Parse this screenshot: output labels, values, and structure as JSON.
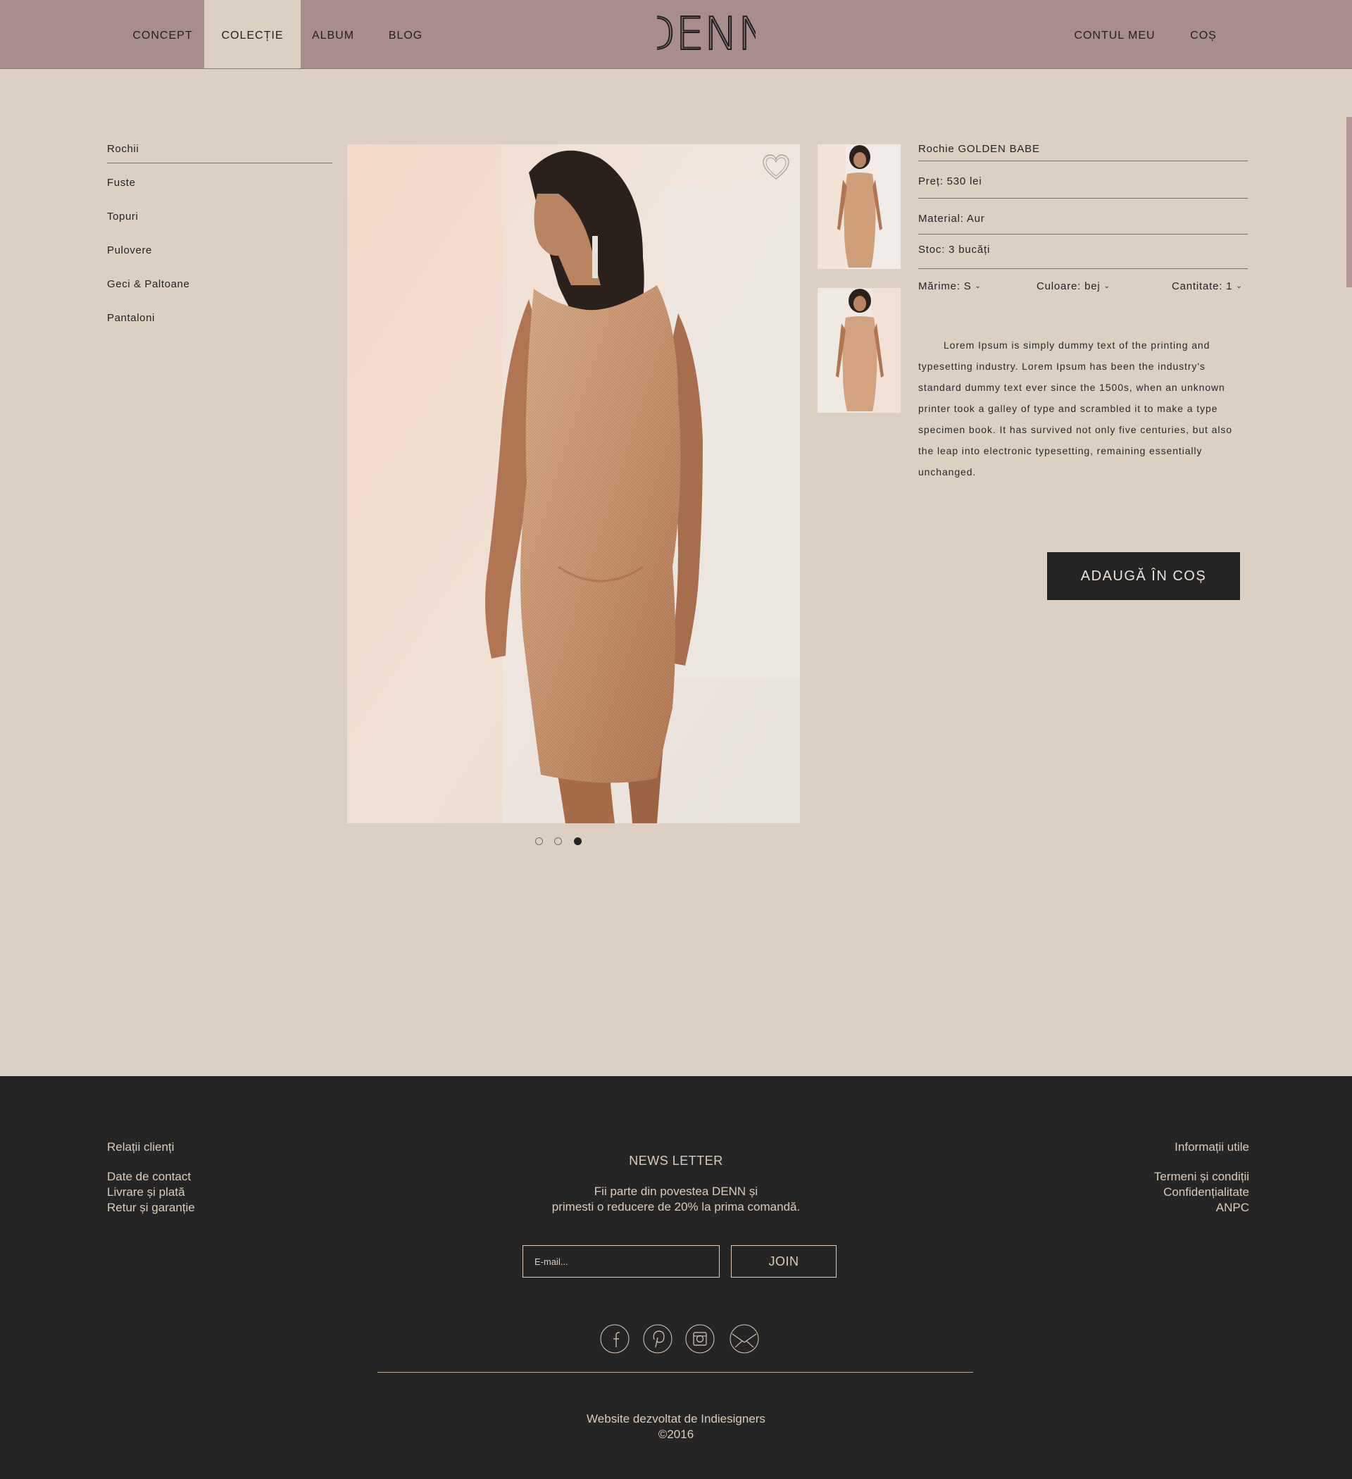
{
  "header": {
    "nav_left": [
      "CONCEPT",
      "COLECȚIE",
      "ALBUM",
      "BLOG"
    ],
    "logo": "DENN",
    "nav_right": [
      "CONTUL MEU",
      "COȘ"
    ]
  },
  "sidebar": {
    "categories": [
      "Rochii",
      "Fuste",
      "Topuri",
      "Pulovere",
      "Geci & Paltoane",
      "Pantaloni"
    ]
  },
  "product": {
    "name": "Rochie GOLDEN BABE",
    "price": "Preț: 530 lei",
    "material": "Material: Aur",
    "stock": "Stoc: 3 bucăți",
    "size": "Mărime: S",
    "color": "Culoare: bej",
    "quantity": "Cantitate: 1",
    "description": "Lorem Ipsum is simply dummy text of the printing and typesetting industry. Lorem Ipsum has been the industry's standard dummy text ever since the 1500s, when an unknown printer took a galley of type and scrambled it to make a type specimen book. It has survived not only five centuries, but also the leap into electronic typesetting, remaining essentially unchanged.",
    "add_to_cart": "ADAUGĂ ÎN COȘ",
    "active_slide": 3,
    "slides": 3
  },
  "footer": {
    "left_title": "Relații clienți",
    "left_links": [
      "Date de contact",
      "Livrare și plată",
      "Retur și garanție"
    ],
    "newsletter_title": "NEWS LETTER",
    "newsletter_line1": "Fii parte din povestea DENN și",
    "newsletter_line2": "primesti o reducere de 20% la prima comandă.",
    "email_placeholder": "E-mail...",
    "join_label": "JOIN",
    "right_title": "Informații utile",
    "right_links": [
      "Termeni și condiții",
      "Confidențialitate",
      "ANPC"
    ],
    "credits_line1": "Website dezvoltat de Indiesigners",
    "credits_line2": "©2016"
  },
  "icons": [
    "heart-icon",
    "facebook-icon",
    "pinterest-icon",
    "instagram-icon",
    "mail-icon",
    "chevron-down-icon"
  ],
  "colors": {
    "header_bg": "#a78d8b",
    "page_bg": "#dcd0c3",
    "footer_bg": "#252525",
    "footer_text": "#ddcab8",
    "button_bg": "#242424"
  }
}
